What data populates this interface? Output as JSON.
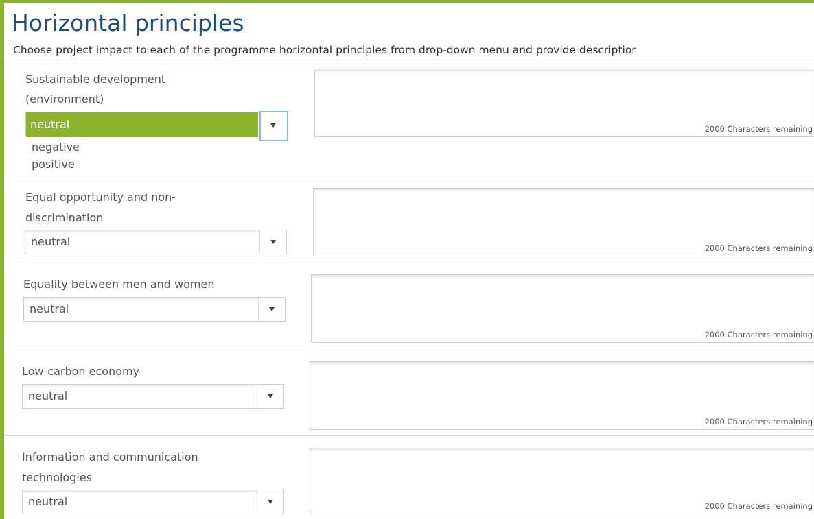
{
  "section": {
    "title": "Horizontal principles",
    "subtitle": "Choose project impact to each of the programme horizontal principles from drop-down menu and provide descriptior"
  },
  "dropdown_options": [
    "neutral",
    "negative",
    "positive"
  ],
  "principles": [
    {
      "label_lines": [
        "Sustainable development",
        "(environment)"
      ],
      "selected": "neutral",
      "dropdown_open": true,
      "counter": "2000 Characters remaining"
    },
    {
      "label_lines": [
        "Equal opportunity and non-",
        "discrimination"
      ],
      "selected": "neutral",
      "dropdown_open": false,
      "counter": "2000 Characters remaining"
    },
    {
      "label_lines": [
        "Equality between men and women"
      ],
      "selected": "neutral",
      "dropdown_open": false,
      "counter": "2000 Characters remaining"
    },
    {
      "label_lines": [
        "Low-carbon economy"
      ],
      "selected": "neutral",
      "dropdown_open": false,
      "counter": "2000 Characters remaining"
    },
    {
      "label_lines": [
        "Information and communication",
        "technologies"
      ],
      "selected": "neutral",
      "dropdown_open": false,
      "counter": "2000 Characters remaining"
    }
  ],
  "colors": {
    "accent": "#8db32c",
    "title": "#1f4e79",
    "text": "#555555",
    "focus_border": "#8fb6e0"
  },
  "icons": {
    "dropdown_arrow": "caret-down-icon"
  }
}
